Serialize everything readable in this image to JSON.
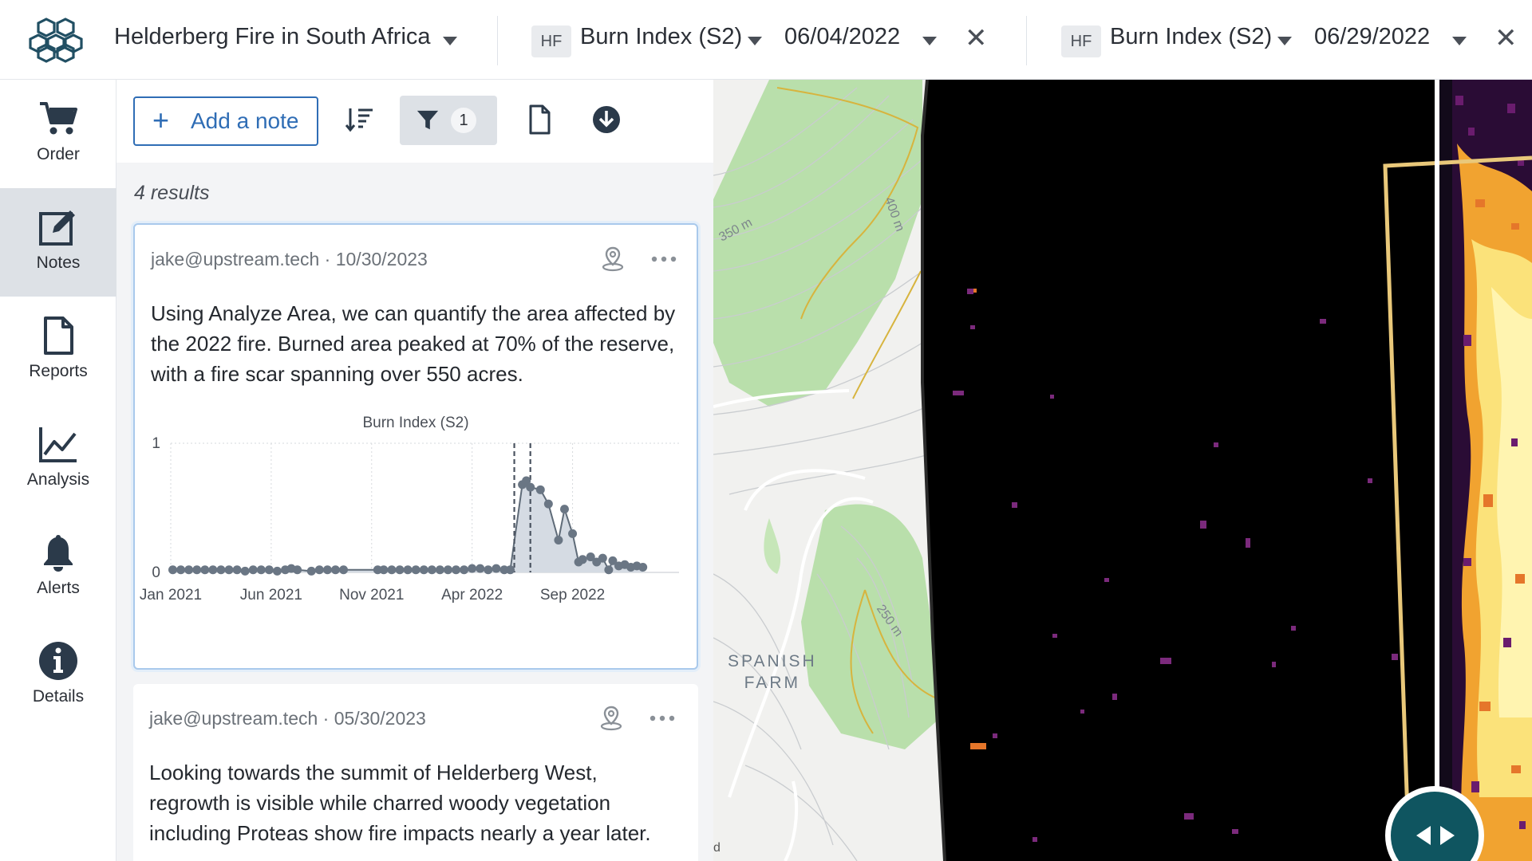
{
  "header": {
    "project_title": "Helderberg Fire in South Africa",
    "left_layer": {
      "badge": "HF",
      "name": "Burn Index (S2)",
      "date": "06/04/2022"
    },
    "right_layer": {
      "badge": "HF",
      "name": "Burn Index (S2)",
      "date": "06/29/2022"
    }
  },
  "rail": {
    "items": [
      {
        "label": "Order",
        "icon": "cart-icon",
        "active": false
      },
      {
        "label": "Notes",
        "icon": "edit-note-icon",
        "active": true
      },
      {
        "label": "Reports",
        "icon": "document-icon",
        "active": false
      },
      {
        "label": "Analysis",
        "icon": "line-chart-icon",
        "active": false
      },
      {
        "label": "Alerts",
        "icon": "bell-icon",
        "active": false
      },
      {
        "label": "Details",
        "icon": "info-icon",
        "active": false
      }
    ]
  },
  "toolbar": {
    "add_note_label": "Add a note",
    "filter_count": "1"
  },
  "results_label": "4 results",
  "notes": [
    {
      "author": "jake@upstream.tech",
      "date": "10/30/2023",
      "meta": "jake@upstream.tech · 10/30/2023",
      "text": "Using Analyze Area, we can quantify the area affected by the 2022 fire. Burned area peaked at 70% of the reserve, with a fire scar spanning over 550 acres."
    },
    {
      "author": "jake@upstream.tech",
      "date": "05/30/2023",
      "meta": "jake@upstream.tech · 05/30/2023",
      "text": "Looking towards the summit of Helderberg West, regrowth is visible while charred woody vegetation including Proteas show fire impacts nearly a year later."
    }
  ],
  "chart_data": {
    "type": "area",
    "title": "Burn Index (S2)",
    "xlabel": "",
    "ylabel": "",
    "ylim": [
      0,
      1
    ],
    "y_ticks": [
      "0",
      "1"
    ],
    "x_ticks": [
      "Jan 2021",
      "Jun 2021",
      "Nov 2021",
      "Apr 2022",
      "Sep 2022"
    ],
    "x_tick_months": [
      0,
      5,
      10,
      15,
      20
    ],
    "markers_months": [
      17.1,
      17.9
    ],
    "series": [
      {
        "x_months": [
          0.1,
          0.5,
          0.9,
          1.3,
          1.7,
          2.1,
          2.5,
          2.9,
          3.3,
          3.7,
          4.1,
          4.5,
          4.9,
          5.3,
          5.7,
          6.0,
          6.3,
          7.0,
          7.4,
          7.8,
          8.2,
          8.6,
          10.3,
          10.6,
          11.0,
          11.4,
          11.8,
          12.2,
          12.6,
          13.0,
          13.4,
          13.8,
          14.2,
          14.6,
          15.0,
          15.4,
          15.8,
          16.2,
          16.6,
          16.9,
          17.5,
          17.7,
          17.9,
          18.4,
          18.8,
          19.3,
          19.6,
          20.0,
          20.3,
          20.5,
          20.9,
          21.2,
          21.5,
          21.8,
          22.0,
          22.3,
          22.6,
          22.9,
          23.2,
          23.5
        ],
        "values": [
          0.02,
          0.02,
          0.02,
          0.02,
          0.02,
          0.02,
          0.02,
          0.02,
          0.02,
          0.01,
          0.02,
          0.02,
          0.02,
          0.01,
          0.02,
          0.03,
          0.02,
          0.01,
          0.02,
          0.02,
          0.02,
          0.02,
          0.02,
          0.02,
          0.02,
          0.02,
          0.02,
          0.02,
          0.02,
          0.02,
          0.02,
          0.02,
          0.02,
          0.02,
          0.03,
          0.03,
          0.02,
          0.03,
          0.02,
          0.02,
          0.68,
          0.71,
          0.66,
          0.64,
          0.53,
          0.25,
          0.49,
          0.3,
          0.08,
          0.1,
          0.12,
          0.08,
          0.11,
          0.02,
          0.09,
          0.05,
          0.06,
          0.04,
          0.05,
          0.04
        ]
      }
    ]
  },
  "map": {
    "place_label_line1": "SPANISH",
    "place_label_line2": "FARM",
    "contour_labels": [
      "350 m",
      "400 m",
      "250 m"
    ],
    "attribution": "d"
  },
  "colors": {
    "accent": "#2f6db5",
    "handle": "#0f5560",
    "vegetation": "#a8d99a",
    "burn_hot": "#fff2a0",
    "burn_mid": "#f59a25",
    "burn_low": "#6a1c6e"
  }
}
